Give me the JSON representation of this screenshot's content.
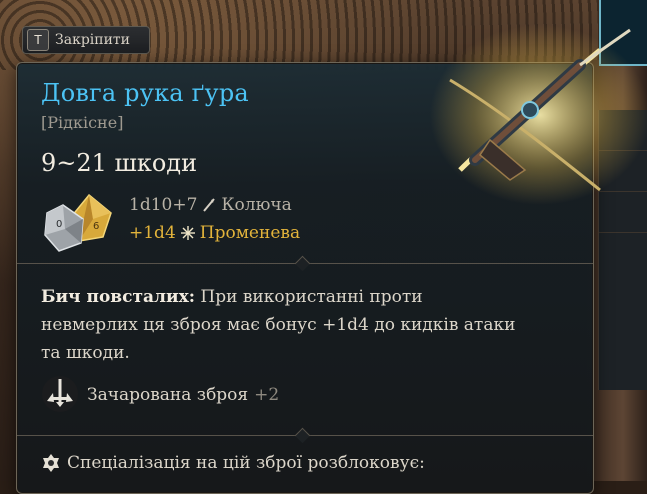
{
  "pin_button": {
    "key": "T",
    "label": "Закріпити"
  },
  "item": {
    "name": "Довга рука ґура",
    "rarity": "[Рідкісне]",
    "damage_range": "9~21 шкоди",
    "damage_lines": [
      {
        "dice": "1d10+7",
        "type": "Колюча",
        "icon": "piercing-icon"
      },
      {
        "dice": "+1d4",
        "type": "Променева",
        "icon": "radiant-icon"
      }
    ],
    "ability": {
      "name": "Бич повсталих:",
      "text_line1": " При використанні проти",
      "text_line2": "невмерлих ця зброя має бонус +1d4 до кидків атаки",
      "text_line3": "та шкоди."
    },
    "enchant": {
      "label": "Зачарована зброя",
      "bonus": "+2"
    },
    "specialization": "Спеціалізація на цій зброї розблоковує:"
  },
  "colors": {
    "title": "#4cc3f4",
    "radiant": "#e2b33b",
    "rarity": "#9f9a90"
  }
}
